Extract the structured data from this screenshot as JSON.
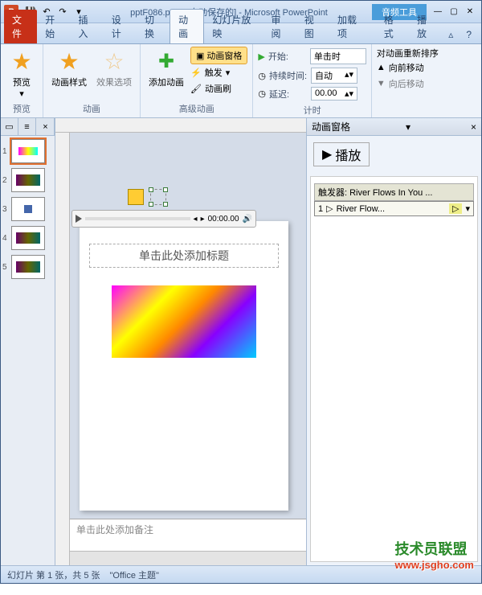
{
  "titlebar": {
    "app_letter": "P",
    "filename": "pptF086.pptm [自动保存的]",
    "app_name": "Microsoft PowerPoint",
    "audio_tools": "音频工具"
  },
  "tabs": {
    "file": "文件",
    "home": "开始",
    "insert": "插入",
    "design": "设计",
    "transition": "切换",
    "animation": "动画",
    "slideshow": "幻灯片放映",
    "review": "审阅",
    "view": "视图",
    "addins": "加载项",
    "format": "格式",
    "play": "播放"
  },
  "ribbon": {
    "preview": "预览",
    "preview_group": "预览",
    "anim_style": "动画样式",
    "effect_opts": "效果选项",
    "anim_group": "动画",
    "add_anim": "添加动画",
    "anim_pane": "动画窗格",
    "trigger": "触发",
    "anim_painter": "动画刷",
    "adv_anim_group": "高级动画",
    "start_lbl": "开始:",
    "start_val": "单击时",
    "duration_lbl": "持续时间:",
    "duration_val": "自动",
    "delay_lbl": "延迟:",
    "delay_val": "00.00",
    "timing_group": "计时",
    "reorder": "对动画重新排序",
    "move_earlier": "向前移动",
    "move_later": "向后移动"
  },
  "thumbs": [
    "1",
    "2",
    "3",
    "4",
    "5"
  ],
  "slide": {
    "title_placeholder": "单击此处添加标题",
    "audio_time": "00:00.00"
  },
  "notes": "单击此处添加备注",
  "anim_pane": {
    "title": "动画窗格",
    "play": "播放",
    "trigger_label": "触发器: River Flows In You ...",
    "item_num": "1",
    "item_text": "River Flow..."
  },
  "status": {
    "slide_info": "幻灯片 第 1 张，共 5 张",
    "theme": "\"Office 主题\""
  },
  "watermark": {
    "name": "技术员联盟",
    "url": "www.jsgho.com"
  }
}
